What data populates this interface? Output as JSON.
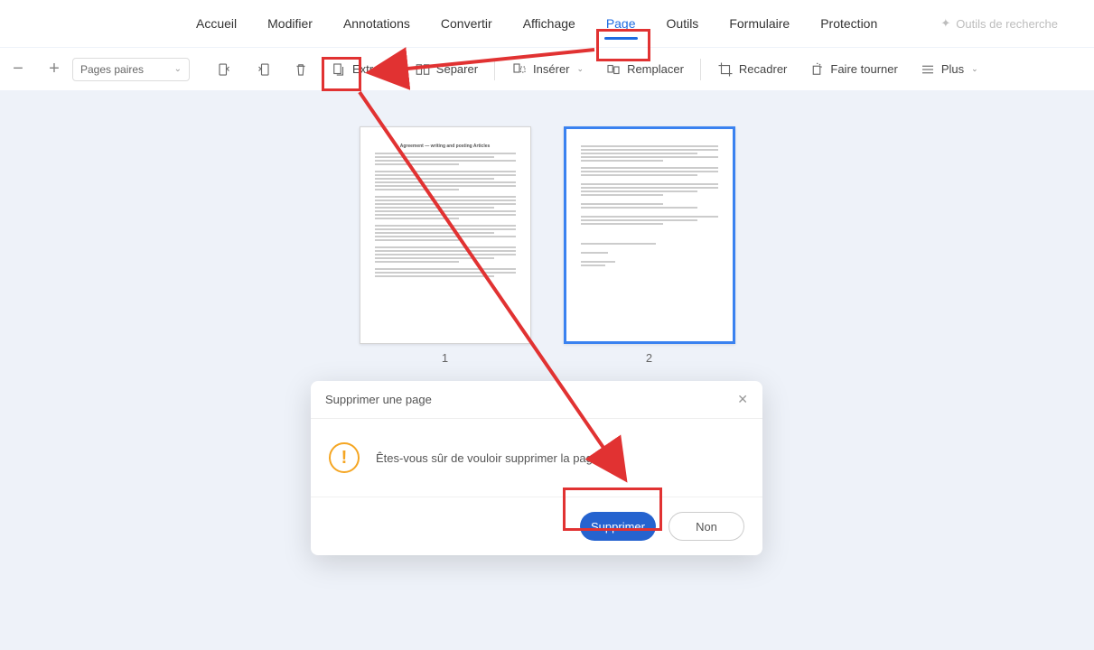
{
  "tabs": {
    "accueil": "Accueil",
    "modifier": "Modifier",
    "annotations": "Annotations",
    "convertir": "Convertir",
    "affichage": "Affichage",
    "page": "Page",
    "outils": "Outils",
    "formulaire": "Formulaire",
    "protection": "Protection",
    "search": "Outils de recherche"
  },
  "toolbar": {
    "dropdown": "Pages paires",
    "extraire": "Extraire",
    "separer": "Séparer",
    "inserer": "Insérer",
    "remplacer": "Remplacer",
    "recadrer": "Recadrer",
    "faire_tourner": "Faire tourner",
    "plus": "Plus"
  },
  "pages": {
    "p1": "1",
    "p2": "2"
  },
  "dialog": {
    "title": "Supprimer une page",
    "message": "Êtes-vous sûr de vouloir supprimer la page ?",
    "confirm": "Supprimer",
    "cancel": "Non"
  }
}
